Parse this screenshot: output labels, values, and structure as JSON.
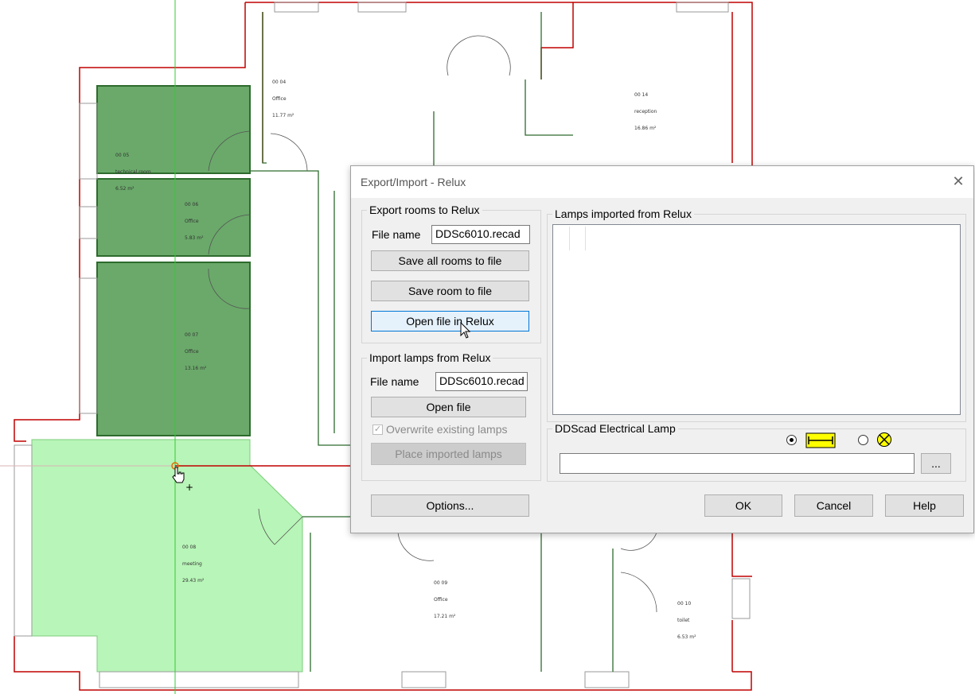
{
  "floorplan": {
    "rooms": [
      {
        "number": "00 04",
        "name": "Office",
        "area": "11.77 m²"
      },
      {
        "number": "00 05",
        "name": "technical room",
        "area": "6.52 m²"
      },
      {
        "number": "00 06",
        "name": "Office",
        "area": "5.83 m²"
      },
      {
        "number": "00 07",
        "name": "Office",
        "area": "13.16 m²"
      },
      {
        "number": "00 08",
        "name": "meeting",
        "area": "29.43 m²"
      },
      {
        "number": "00 09",
        "name": "Office",
        "area": "17.21 m²"
      },
      {
        "number": "00 10",
        "name": "toilet",
        "area": "6.53 m²"
      },
      {
        "number": "00 14",
        "name": "reception",
        "area": "16.86 m²"
      }
    ],
    "colors": {
      "wall": "#c00000",
      "room_wall": "#2e7d32",
      "room_fill": "#6aa96a",
      "selected_fill": "#b5f5b5",
      "crosshair": "#33cc33"
    }
  },
  "dialog": {
    "title": "Export/Import - Relux",
    "close_icon": "close-icon",
    "export_group": {
      "legend": "Export rooms to Relux",
      "file_label": "File name",
      "file_value": "DDSc6010.recad",
      "save_all": "Save all rooms to file",
      "save_room": "Save room to file",
      "open_in_relux": "Open file in Relux"
    },
    "import_group": {
      "legend": "Import lamps from Relux",
      "file_label": "File name",
      "file_value": "DDSc6010.recad",
      "open_file": "Open file",
      "overwrite_label": "Overwrite existing lamps",
      "overwrite_checked": true,
      "place_lamps": "Place imported lamps"
    },
    "lamps_group": {
      "legend": "Lamps imported from Relux"
    },
    "electrical_group": {
      "legend": "DDScad Electrical Lamp",
      "browse": "..."
    },
    "buttons": {
      "options": "Options...",
      "ok": "OK",
      "cancel": "Cancel",
      "help": "Help"
    }
  }
}
